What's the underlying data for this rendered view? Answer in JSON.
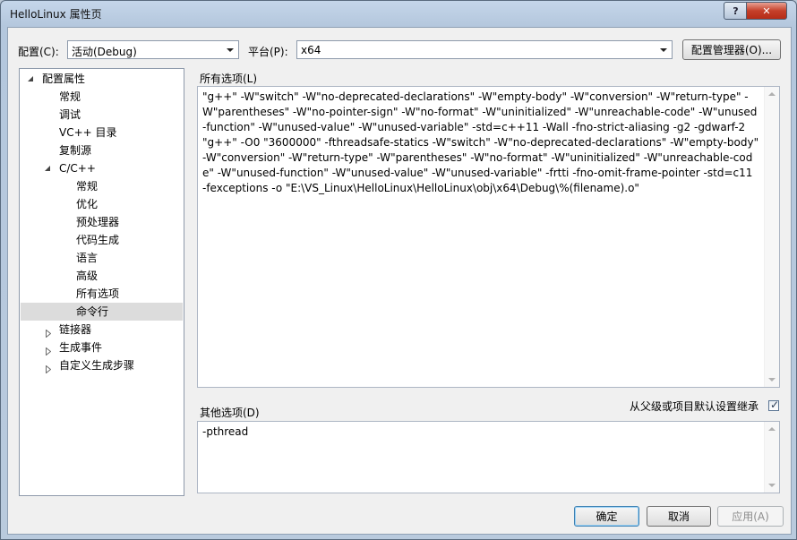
{
  "window": {
    "title": "HelloLinux 属性页",
    "help_label": "?",
    "close_label": "✕"
  },
  "toolbar": {
    "config_label": "配置(C):",
    "config_value": "活动(Debug)",
    "platform_label": "平台(P):",
    "platform_value": "x64",
    "config_manager_label": "配置管理器(O)..."
  },
  "tree": {
    "items": [
      {
        "label": "配置属性",
        "level": 0,
        "expander": "open"
      },
      {
        "label": "常规",
        "level": 1
      },
      {
        "label": "调试",
        "level": 1
      },
      {
        "label": "VC++ 目录",
        "level": 1
      },
      {
        "label": "复制源",
        "level": 1
      },
      {
        "label": "C/C++",
        "level": 1,
        "expander": "open"
      },
      {
        "label": "常规",
        "level": 2
      },
      {
        "label": "优化",
        "level": 2
      },
      {
        "label": "预处理器",
        "level": 2
      },
      {
        "label": "代码生成",
        "level": 2
      },
      {
        "label": "语言",
        "level": 2
      },
      {
        "label": "高级",
        "level": 2
      },
      {
        "label": "所有选项",
        "level": 2
      },
      {
        "label": "命令行",
        "level": 2,
        "selected": true
      },
      {
        "label": "链接器",
        "level": 1,
        "expander": "closed"
      },
      {
        "label": "生成事件",
        "level": 1,
        "expander": "closed"
      },
      {
        "label": "自定义生成步骤",
        "level": 1,
        "expander": "closed"
      }
    ]
  },
  "all_options": {
    "label": "所有选项(L)",
    "text": "\"g++\" -W\"switch\" -W\"no-deprecated-declarations\" -W\"empty-body\" -W\"conversion\" -W\"return-type\" -W\"parentheses\" -W\"no-pointer-sign\" -W\"no-format\" -W\"uninitialized\" -W\"unreachable-code\" -W\"unused-function\" -W\"unused-value\" -W\"unused-variable\" -std=c++11 -Wall -fno-strict-aliasing -g2 -gdwarf-2 \"g++\" -O0 \"3600000\" -fthreadsafe-statics -W\"switch\" -W\"no-deprecated-declarations\" -W\"empty-body\" -W\"conversion\" -W\"return-type\" -W\"parentheses\" -W\"no-format\" -W\"uninitialized\" -W\"unreachable-code\" -W\"unused-function\" -W\"unused-value\" -W\"unused-variable\" -frtti -fno-omit-frame-pointer -std=c11 -fexceptions -o \"E:\\VS_Linux\\HelloLinux\\HelloLinux\\obj\\x64\\Debug\\%(filename).o\""
  },
  "other_options": {
    "label": "其他选项(D)",
    "inherit_label": "从父级或项目默认设置继承",
    "inherit_checked": true,
    "value": "-pthread"
  },
  "footer": {
    "ok_label": "确定",
    "cancel_label": "取消",
    "apply_label": "应用(A)"
  }
}
